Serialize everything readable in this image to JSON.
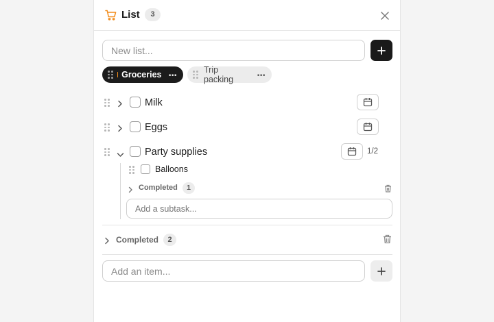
{
  "header": {
    "title": "List",
    "count": "3",
    "icon": "cart-icon",
    "accent": "#f28c1b"
  },
  "new_list": {
    "placeholder": "New list..."
  },
  "lists": [
    {
      "label": "Groceries",
      "active": true,
      "dot_color": "#f28c1b"
    },
    {
      "label": "Trip packing",
      "active": false
    }
  ],
  "items": [
    {
      "label": "Milk",
      "expanded": false
    },
    {
      "label": "Eggs",
      "expanded": false
    },
    {
      "label": "Party supplies",
      "expanded": true,
      "progress": "1/2"
    }
  ],
  "subtasks": [
    {
      "label": "Balloons"
    }
  ],
  "subtask_completed": {
    "label": "Completed",
    "count": "1"
  },
  "add_subtask": {
    "placeholder": "Add a subtask..."
  },
  "completed": {
    "label": "Completed",
    "count": "2"
  },
  "add_item": {
    "placeholder": "Add an item..."
  }
}
